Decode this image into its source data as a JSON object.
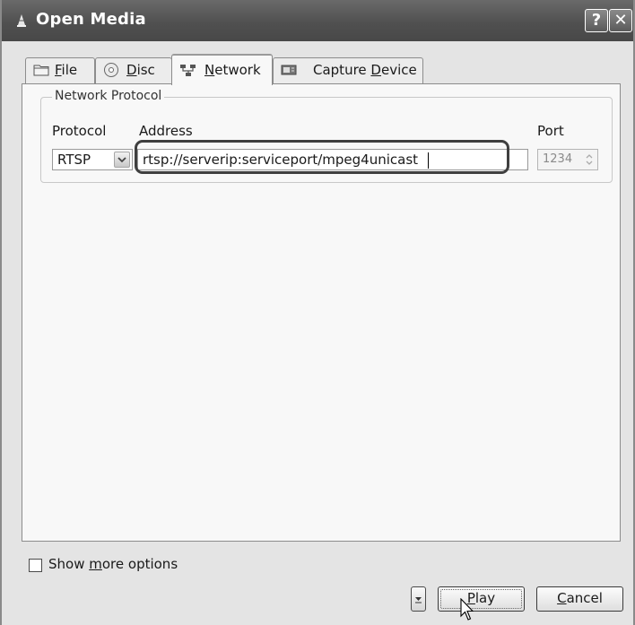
{
  "window": {
    "title": "Open Media",
    "help_glyph": "?",
    "close_glyph": "✕"
  },
  "tabs": [
    {
      "pre": "",
      "mnemonic": "F",
      "post": "ile",
      "icon": "folder-icon"
    },
    {
      "pre": "",
      "mnemonic": "D",
      "post": "isc",
      "icon": "disc-icon"
    },
    {
      "pre": "",
      "mnemonic": "N",
      "post": "etwork",
      "icon": "network-icon",
      "selected": true
    },
    {
      "pre": "Capture ",
      "mnemonic": "D",
      "post": "evice",
      "icon": "capture-card-icon"
    }
  ],
  "network": {
    "group_title": "Network Protocol",
    "protocol_label": "Protocol",
    "address_label": "Address",
    "port_label": "Port",
    "protocol_value": "RTSP",
    "address_value": "rtsp://serverip:serviceport/mpeg4unicast",
    "port_value": "1234"
  },
  "options": {
    "pre": "Show ",
    "mnemonic": "m",
    "post": "ore options",
    "checked": false
  },
  "buttons": {
    "play_mnemonic": "P",
    "play_rest": "lay",
    "cancel_mnemonic": "C",
    "cancel_rest": "ancel"
  }
}
